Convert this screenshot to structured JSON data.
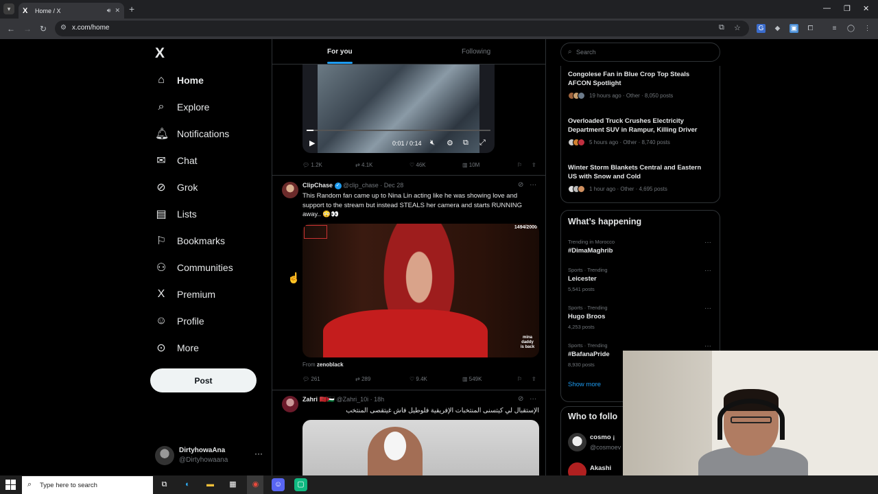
{
  "browser": {
    "tab_title": "Home / X",
    "tab_favicon": "X",
    "url": "x.com/home"
  },
  "sidebar": {
    "logo": "X",
    "items": [
      {
        "label": "Home",
        "icon": "home-icon",
        "glyph": "⌂"
      },
      {
        "label": "Explore",
        "icon": "search-icon",
        "glyph": "⌕"
      },
      {
        "label": "Notifications",
        "icon": "bell-icon",
        "glyph": "🔔︎"
      },
      {
        "label": "Chat",
        "icon": "mail-icon",
        "glyph": "✉"
      },
      {
        "label": "Grok",
        "icon": "grok-icon",
        "glyph": "⊘"
      },
      {
        "label": "Lists",
        "icon": "list-icon",
        "glyph": "▤"
      },
      {
        "label": "Bookmarks",
        "icon": "bookmark-icon",
        "glyph": "⚐"
      },
      {
        "label": "Communities",
        "icon": "communities-icon",
        "glyph": "⚇"
      },
      {
        "label": "Premium",
        "icon": "x-premium-icon",
        "glyph": "X"
      },
      {
        "label": "Profile",
        "icon": "person-icon",
        "glyph": "☺"
      },
      {
        "label": "More",
        "icon": "more-circle-icon",
        "glyph": "⊙"
      }
    ],
    "post_label": "Post",
    "account": {
      "name": "DirtyhowaAna",
      "handle": "@Dirtyhowaana"
    }
  },
  "feed": {
    "tabs": [
      "For you",
      "Following"
    ],
    "tweet1": {
      "video_time": "0:01 / 0:14",
      "stats": {
        "replies": "1.2K",
        "reposts": "4.1K",
        "likes": "46K",
        "views": "10M"
      }
    },
    "tweet2": {
      "name": "ClipChase",
      "handle": "@clip_chase",
      "date": "· Dec 28",
      "text": "This Random fan came up to Nina Lin acting like he was showing love and support to the stream but instead STEALS her camera and starts RUNNING away.. 😳👀",
      "media_counter": "1494/2000",
      "watermark": "mina daddy is back",
      "from_prefix": "From",
      "from_source": "zenoblack",
      "stats": {
        "replies": "261",
        "reposts": "289",
        "likes": "9.4K",
        "views": "549K"
      }
    },
    "tweet3": {
      "name": "Zahri",
      "flags": "🇲🇦🇵🇸",
      "handle": "@Zahri_10i",
      "date": "· 18h",
      "text": "الإستقبال لي كيتسنى المنتخبات الإفريقية فلوطيل فاش غيتقصى المنتخب"
    }
  },
  "right": {
    "search_placeholder": "Search",
    "news": [
      {
        "title": "Congolese Fan in Blue Crop Top Steals AFCON Spotlight",
        "meta": "19 hours ago · Other · 8,050 posts"
      },
      {
        "title": "Overloaded Truck Crushes Electricity Department SUV in Rampur, Killing Driver",
        "meta": "5 hours ago · Other · 8,740 posts"
      },
      {
        "title": "Winter Storm Blankets Central and Eastern US with Snow and Cold",
        "meta": "1 hour ago · Other · 4,695 posts"
      }
    ],
    "whats_happening": "What’s happening",
    "trends": [
      {
        "category": "Trending in Morocco",
        "name": "#DimaMaghrib",
        "count": ""
      },
      {
        "category": "Sports · Trending",
        "name": "Leicester",
        "count": "5,541 posts"
      },
      {
        "category": "Sports · Trending",
        "name": "Hugo Broos",
        "count": "4,253 posts"
      },
      {
        "category": "Sports · Trending",
        "name": "#BafanaPride",
        "count": "8,930 posts"
      }
    ],
    "show_more": "Show more",
    "who_to_follow": "Who to follo",
    "follow": [
      {
        "name": "cosmo ¡",
        "handle": "@cosmoev"
      },
      {
        "name": "Akashi",
        "handle": ""
      }
    ]
  },
  "taskbar": {
    "search_placeholder": "Type here to search"
  },
  "colors": {
    "accent": "#1d9bf0",
    "background": "#000000",
    "text": "#e7e9ea",
    "muted": "#71767b"
  }
}
